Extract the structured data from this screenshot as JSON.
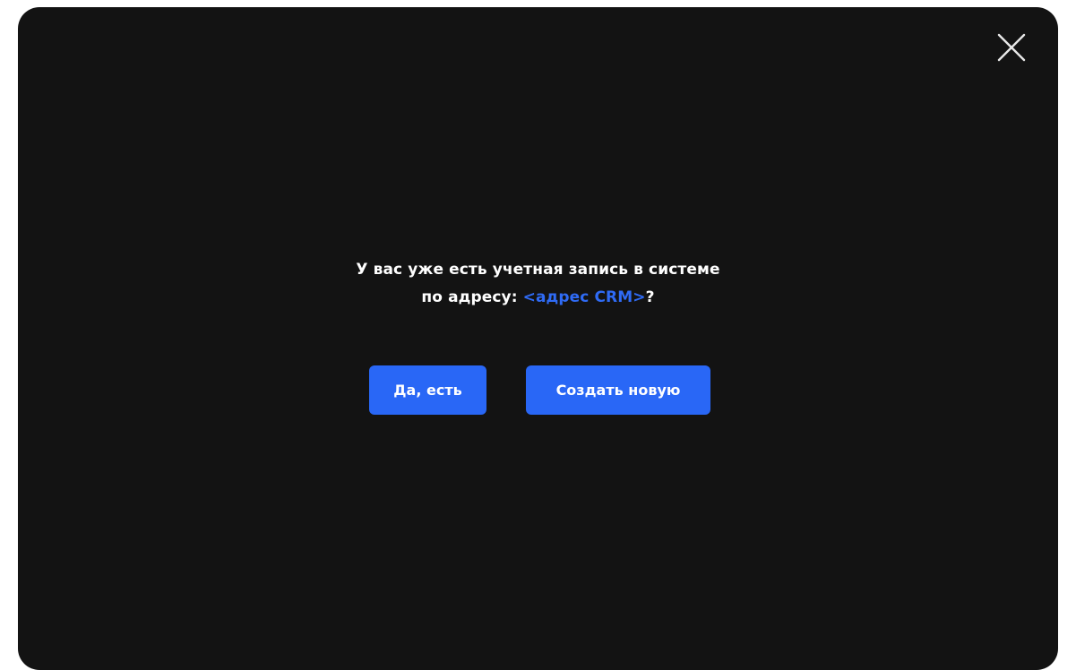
{
  "dialog": {
    "question_line1": "У вас уже есть учетная запись в системе",
    "question_prefix": "по адресу: ",
    "question_link": "<адрес CRM>",
    "question_suffix": "?",
    "link_color": "#2f6bf5"
  },
  "buttons": {
    "yes_label": "Да, есть",
    "create_label": "Создать новую",
    "color": "#2967f6"
  },
  "icons": {
    "close": "close-icon"
  }
}
